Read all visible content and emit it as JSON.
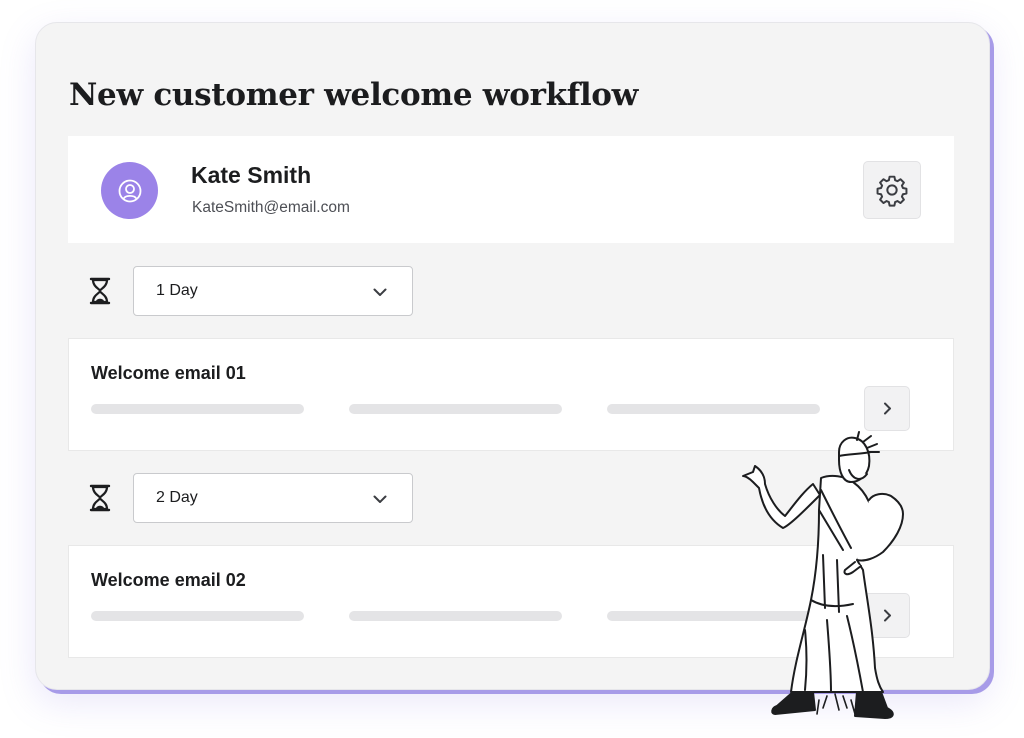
{
  "workflow": {
    "title": "New customer welcome workflow"
  },
  "user": {
    "name": "Kate Smith",
    "email": "KateSmith@email.com",
    "avatar_icon": "user-circle-icon"
  },
  "settings": {
    "icon": "gear-icon"
  },
  "steps": [
    {
      "delay": {
        "icon": "hourglass-icon",
        "value": "1 Day"
      },
      "email": {
        "title": "Welcome email 01",
        "open_icon": "chevron-right-icon"
      }
    },
    {
      "delay": {
        "icon": "hourglass-icon",
        "value": "2 Day"
      },
      "email": {
        "title": "Welcome email 02",
        "open_icon": "chevron-right-icon"
      }
    }
  ],
  "colors": {
    "accent": "#9b83e8",
    "panel_shadow": "#a79be8",
    "panel_bg": "#f4f4f4"
  },
  "illustration": {
    "icon": "hermes-mascot-illustration"
  }
}
